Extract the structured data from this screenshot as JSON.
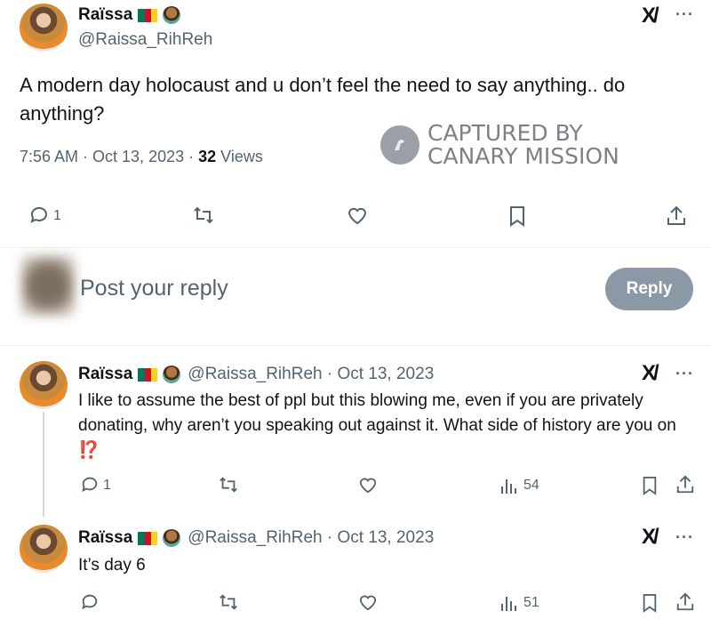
{
  "main_tweet": {
    "display_name": "Raïssa",
    "handle": "@Raissa_RihReh",
    "text": "A modern day holocaust and u don’t feel the need to say anything.. do anything?",
    "time": "7:56 AM · Oct 13, 2023 · ",
    "views_count": "32",
    "views_label": " Views",
    "replies": "1"
  },
  "watermark": {
    "line1": "CAPTURED BY",
    "line2": "CANARY MISSION"
  },
  "reply_box": {
    "placeholder": "Post your reply",
    "button": "Reply"
  },
  "replies": [
    {
      "display_name": "Raïssa",
      "handle_date": "@Raissa_RihReh · Oct 13, 2023",
      "text": "I like to assume the best of ppl but this blowing me, even if you are privately donating, why aren’t you speaking out against it. What side of history are you on ",
      "emoji": "⁉️",
      "replies": "1",
      "views": "54"
    },
    {
      "display_name": "Raïssa",
      "handle_date": "@Raissa_RihReh · Oct 13, 2023",
      "text": "It’s day 6",
      "views": "51"
    }
  ],
  "colors": {
    "text": "#0f1419",
    "secondary": "#536471",
    "reply_button": "#8b98a5",
    "flag_green": "#007a5e",
    "flag_red": "#ce1126",
    "flag_yellow": "#fcd116"
  },
  "icons": [
    "x-logo-icon",
    "more-icon",
    "reply-icon",
    "retweet-icon",
    "like-icon",
    "bookmark-icon",
    "share-icon",
    "views-icon",
    "canary-icon",
    "flag-icon",
    "person-emoji-icon"
  ]
}
